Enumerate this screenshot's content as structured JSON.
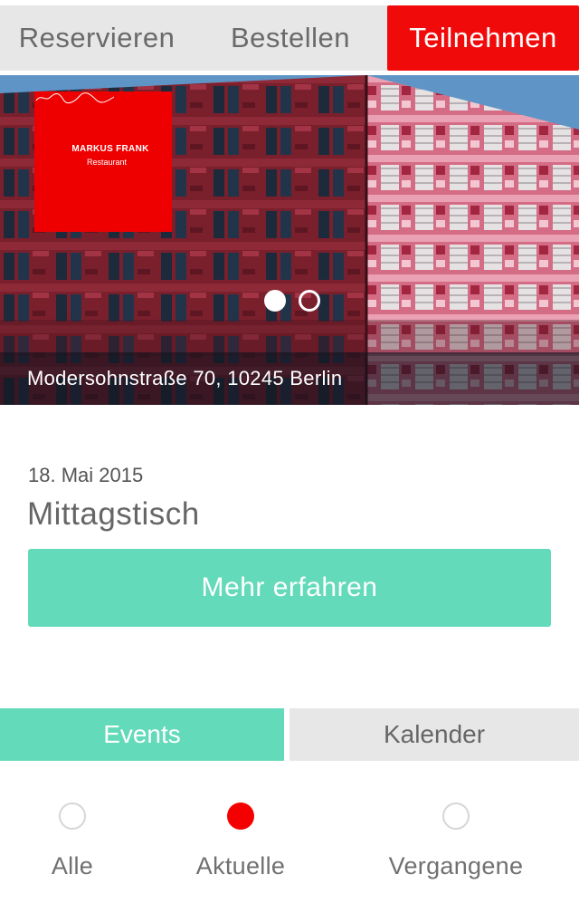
{
  "top_tabs": [
    {
      "label": "Reservieren",
      "active": false
    },
    {
      "label": "Bestellen",
      "active": false
    },
    {
      "label": "Teilnehmen",
      "active": true
    }
  ],
  "hero": {
    "logo": {
      "name": "MARKUS FRANK",
      "subtitle": "Restaurant"
    },
    "slides_count": 2,
    "active_slide": 1,
    "address": "Modersohnstraße 70, 10245 Berlin"
  },
  "event": {
    "date": "18. Mai 2015",
    "title": "Mittagstisch",
    "more_label": "Mehr erfahren"
  },
  "sub_tabs": [
    {
      "label": "Events",
      "active": true
    },
    {
      "label": "Kalender",
      "active": false
    }
  ],
  "filters": [
    {
      "label": "Alle",
      "selected": false
    },
    {
      "label": "Aktuelle",
      "selected": true
    },
    {
      "label": "Vergangene",
      "selected": false
    }
  ],
  "colors": {
    "accent_red": "#f10a0a",
    "accent_green": "#63dab9",
    "inactive_tab": "#e7e7e7"
  }
}
